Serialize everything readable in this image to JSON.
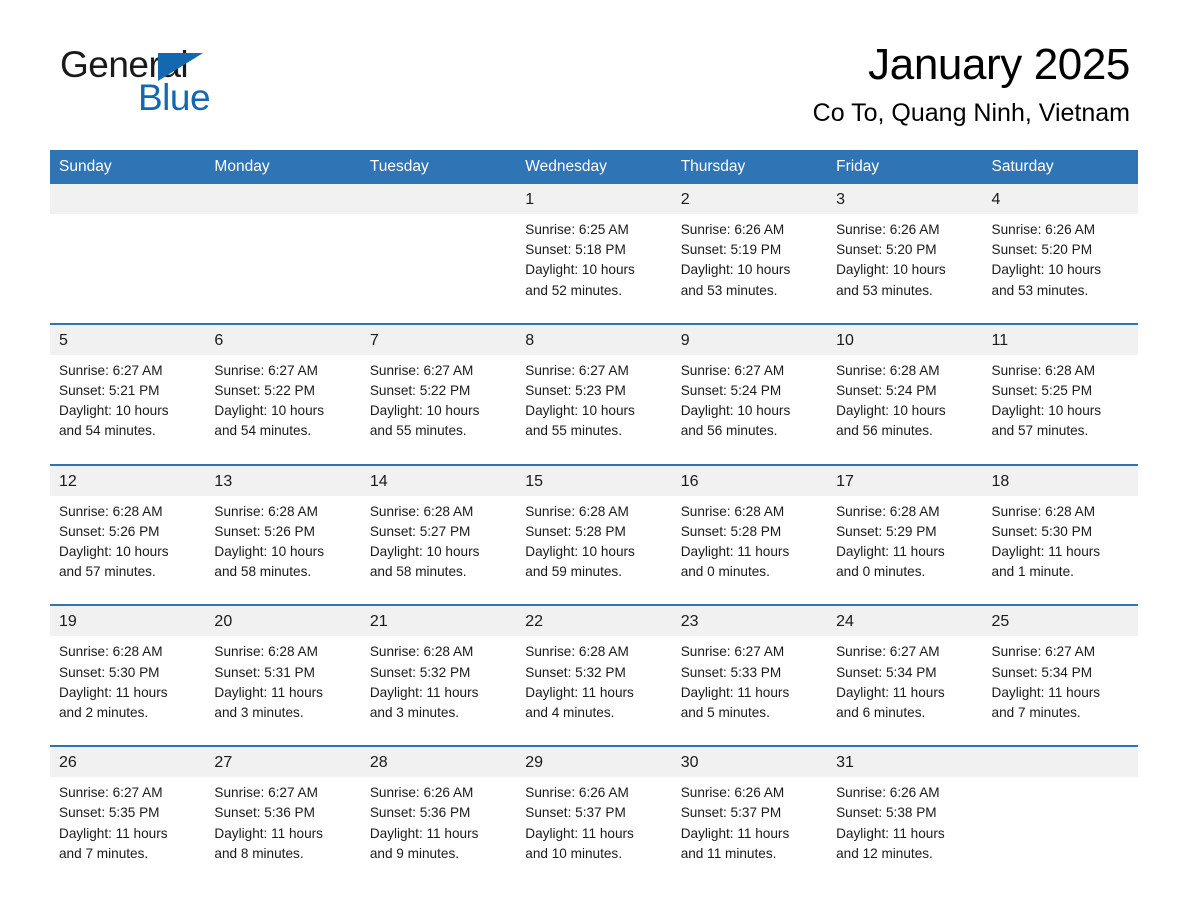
{
  "logo": {
    "word1": "General",
    "word2": "Blue",
    "triangle_color": "#1368b0",
    "text_color": "#1a1a1a"
  },
  "header": {
    "title": "January 2025",
    "subtitle": "Co To, Quang Ninh, Vietnam"
  },
  "theme": {
    "header_blue": "#2f74b5",
    "date_band": "#f1f1f1",
    "cell_bg": "#ffffff",
    "text": "#1a1a1a"
  },
  "weekday_headers": [
    "Sunday",
    "Monday",
    "Tuesday",
    "Wednesday",
    "Thursday",
    "Friday",
    "Saturday"
  ],
  "weeks": [
    [
      {
        "day": "",
        "sunrise": "",
        "sunset": "",
        "daylight1": "",
        "daylight2": ""
      },
      {
        "day": "",
        "sunrise": "",
        "sunset": "",
        "daylight1": "",
        "daylight2": ""
      },
      {
        "day": "",
        "sunrise": "",
        "sunset": "",
        "daylight1": "",
        "daylight2": ""
      },
      {
        "day": "1",
        "sunrise": "Sunrise: 6:25 AM",
        "sunset": "Sunset: 5:18 PM",
        "daylight1": "Daylight: 10 hours",
        "daylight2": "and 52 minutes."
      },
      {
        "day": "2",
        "sunrise": "Sunrise: 6:26 AM",
        "sunset": "Sunset: 5:19 PM",
        "daylight1": "Daylight: 10 hours",
        "daylight2": "and 53 minutes."
      },
      {
        "day": "3",
        "sunrise": "Sunrise: 6:26 AM",
        "sunset": "Sunset: 5:20 PM",
        "daylight1": "Daylight: 10 hours",
        "daylight2": "and 53 minutes."
      },
      {
        "day": "4",
        "sunrise": "Sunrise: 6:26 AM",
        "sunset": "Sunset: 5:20 PM",
        "daylight1": "Daylight: 10 hours",
        "daylight2": "and 53 minutes."
      }
    ],
    [
      {
        "day": "5",
        "sunrise": "Sunrise: 6:27 AM",
        "sunset": "Sunset: 5:21 PM",
        "daylight1": "Daylight: 10 hours",
        "daylight2": "and 54 minutes."
      },
      {
        "day": "6",
        "sunrise": "Sunrise: 6:27 AM",
        "sunset": "Sunset: 5:22 PM",
        "daylight1": "Daylight: 10 hours",
        "daylight2": "and 54 minutes."
      },
      {
        "day": "7",
        "sunrise": "Sunrise: 6:27 AM",
        "sunset": "Sunset: 5:22 PM",
        "daylight1": "Daylight: 10 hours",
        "daylight2": "and 55 minutes."
      },
      {
        "day": "8",
        "sunrise": "Sunrise: 6:27 AM",
        "sunset": "Sunset: 5:23 PM",
        "daylight1": "Daylight: 10 hours",
        "daylight2": "and 55 minutes."
      },
      {
        "day": "9",
        "sunrise": "Sunrise: 6:27 AM",
        "sunset": "Sunset: 5:24 PM",
        "daylight1": "Daylight: 10 hours",
        "daylight2": "and 56 minutes."
      },
      {
        "day": "10",
        "sunrise": "Sunrise: 6:28 AM",
        "sunset": "Sunset: 5:24 PM",
        "daylight1": "Daylight: 10 hours",
        "daylight2": "and 56 minutes."
      },
      {
        "day": "11",
        "sunrise": "Sunrise: 6:28 AM",
        "sunset": "Sunset: 5:25 PM",
        "daylight1": "Daylight: 10 hours",
        "daylight2": "and 57 minutes."
      }
    ],
    [
      {
        "day": "12",
        "sunrise": "Sunrise: 6:28 AM",
        "sunset": "Sunset: 5:26 PM",
        "daylight1": "Daylight: 10 hours",
        "daylight2": "and 57 minutes."
      },
      {
        "day": "13",
        "sunrise": "Sunrise: 6:28 AM",
        "sunset": "Sunset: 5:26 PM",
        "daylight1": "Daylight: 10 hours",
        "daylight2": "and 58 minutes."
      },
      {
        "day": "14",
        "sunrise": "Sunrise: 6:28 AM",
        "sunset": "Sunset: 5:27 PM",
        "daylight1": "Daylight: 10 hours",
        "daylight2": "and 58 minutes."
      },
      {
        "day": "15",
        "sunrise": "Sunrise: 6:28 AM",
        "sunset": "Sunset: 5:28 PM",
        "daylight1": "Daylight: 10 hours",
        "daylight2": "and 59 minutes."
      },
      {
        "day": "16",
        "sunrise": "Sunrise: 6:28 AM",
        "sunset": "Sunset: 5:28 PM",
        "daylight1": "Daylight: 11 hours",
        "daylight2": "and 0 minutes."
      },
      {
        "day": "17",
        "sunrise": "Sunrise: 6:28 AM",
        "sunset": "Sunset: 5:29 PM",
        "daylight1": "Daylight: 11 hours",
        "daylight2": "and 0 minutes."
      },
      {
        "day": "18",
        "sunrise": "Sunrise: 6:28 AM",
        "sunset": "Sunset: 5:30 PM",
        "daylight1": "Daylight: 11 hours",
        "daylight2": "and 1 minute."
      }
    ],
    [
      {
        "day": "19",
        "sunrise": "Sunrise: 6:28 AM",
        "sunset": "Sunset: 5:30 PM",
        "daylight1": "Daylight: 11 hours",
        "daylight2": "and 2 minutes."
      },
      {
        "day": "20",
        "sunrise": "Sunrise: 6:28 AM",
        "sunset": "Sunset: 5:31 PM",
        "daylight1": "Daylight: 11 hours",
        "daylight2": "and 3 minutes."
      },
      {
        "day": "21",
        "sunrise": "Sunrise: 6:28 AM",
        "sunset": "Sunset: 5:32 PM",
        "daylight1": "Daylight: 11 hours",
        "daylight2": "and 3 minutes."
      },
      {
        "day": "22",
        "sunrise": "Sunrise: 6:28 AM",
        "sunset": "Sunset: 5:32 PM",
        "daylight1": "Daylight: 11 hours",
        "daylight2": "and 4 minutes."
      },
      {
        "day": "23",
        "sunrise": "Sunrise: 6:27 AM",
        "sunset": "Sunset: 5:33 PM",
        "daylight1": "Daylight: 11 hours",
        "daylight2": "and 5 minutes."
      },
      {
        "day": "24",
        "sunrise": "Sunrise: 6:27 AM",
        "sunset": "Sunset: 5:34 PM",
        "daylight1": "Daylight: 11 hours",
        "daylight2": "and 6 minutes."
      },
      {
        "day": "25",
        "sunrise": "Sunrise: 6:27 AM",
        "sunset": "Sunset: 5:34 PM",
        "daylight1": "Daylight: 11 hours",
        "daylight2": "and 7 minutes."
      }
    ],
    [
      {
        "day": "26",
        "sunrise": "Sunrise: 6:27 AM",
        "sunset": "Sunset: 5:35 PM",
        "daylight1": "Daylight: 11 hours",
        "daylight2": "and 7 minutes."
      },
      {
        "day": "27",
        "sunrise": "Sunrise: 6:27 AM",
        "sunset": "Sunset: 5:36 PM",
        "daylight1": "Daylight: 11 hours",
        "daylight2": "and 8 minutes."
      },
      {
        "day": "28",
        "sunrise": "Sunrise: 6:26 AM",
        "sunset": "Sunset: 5:36 PM",
        "daylight1": "Daylight: 11 hours",
        "daylight2": "and 9 minutes."
      },
      {
        "day": "29",
        "sunrise": "Sunrise: 6:26 AM",
        "sunset": "Sunset: 5:37 PM",
        "daylight1": "Daylight: 11 hours",
        "daylight2": "and 10 minutes."
      },
      {
        "day": "30",
        "sunrise": "Sunrise: 6:26 AM",
        "sunset": "Sunset: 5:37 PM",
        "daylight1": "Daylight: 11 hours",
        "daylight2": "and 11 minutes."
      },
      {
        "day": "31",
        "sunrise": "Sunrise: 6:26 AM",
        "sunset": "Sunset: 5:38 PM",
        "daylight1": "Daylight: 11 hours",
        "daylight2": "and 12 minutes."
      },
      {
        "day": "",
        "sunrise": "",
        "sunset": "",
        "daylight1": "",
        "daylight2": ""
      }
    ]
  ]
}
